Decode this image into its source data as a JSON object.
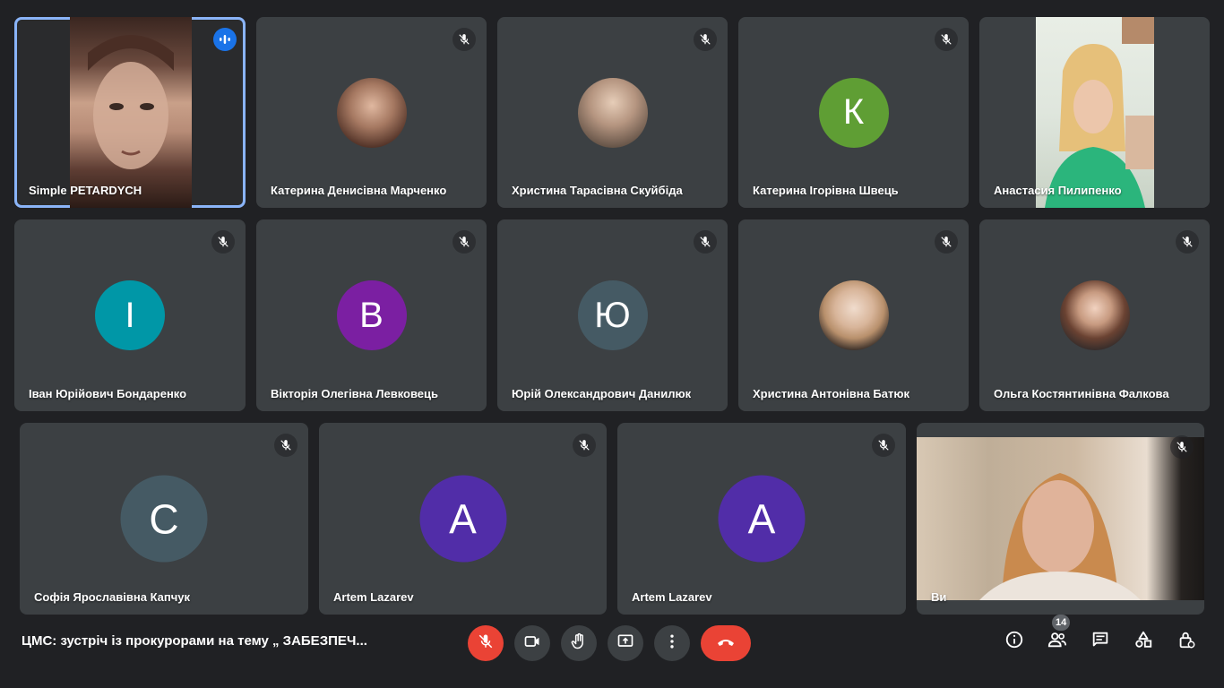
{
  "meeting": {
    "title": "ЦМС: зустріч із прокурорами на тему „ ЗАБЕЗПЕЧ...",
    "participants_count": "14"
  },
  "participants": [
    {
      "name": "Simple PETARDYCH",
      "type": "video",
      "active": true
    },
    {
      "name": "Катерина Денисівна Марченко",
      "type": "photo",
      "muted": true
    },
    {
      "name": "Христина Тарасівна Скуйбіда",
      "type": "photo",
      "muted": true
    },
    {
      "name": "Катерина Ігорівна Швець",
      "type": "initial",
      "initial": "К",
      "color": "#5f9e34",
      "muted": true
    },
    {
      "name": "Анастасия Пилипенко",
      "type": "video"
    },
    {
      "name": "Іван Юрійович Бондаренко",
      "type": "initial",
      "initial": "І",
      "color": "#0097a7",
      "muted": true
    },
    {
      "name": "Вікторія Олегівна Левковець",
      "type": "initial",
      "initial": "В",
      "color": "#7b1fa2",
      "muted": true
    },
    {
      "name": "Юрій Олександрович Данилюк",
      "type": "initial",
      "initial": "Ю",
      "color": "#455a64",
      "muted": true
    },
    {
      "name": "Христина Антонівна Батюк",
      "type": "photo",
      "muted": true
    },
    {
      "name": "Ольга Костянтинівна Фалкова",
      "type": "photo",
      "muted": true
    },
    {
      "name": "Софія Ярославівна Капчук",
      "type": "initial",
      "initial": "С",
      "color": "#455a64",
      "muted": true
    },
    {
      "name": "Artem Lazarev",
      "type": "initial",
      "initial": "A",
      "color": "#512da8",
      "muted": true
    },
    {
      "name": "Artem Lazarev",
      "type": "initial",
      "initial": "A",
      "color": "#512da8",
      "muted": true
    },
    {
      "name": "Ви",
      "type": "video",
      "muted": true
    }
  ],
  "controls": {
    "icons": [
      "mic-off-icon",
      "camera-icon",
      "raise-hand-icon",
      "present-icon",
      "more-options-icon",
      "hangup-icon"
    ],
    "right_icons": [
      "info-icon",
      "people-icon",
      "chat-icon",
      "activities-icon",
      "host-controls-icon"
    ]
  },
  "colors": {
    "background": "#202124",
    "tile": "#3c4043",
    "accent": "#8ab4f8",
    "danger": "#ea4335"
  }
}
